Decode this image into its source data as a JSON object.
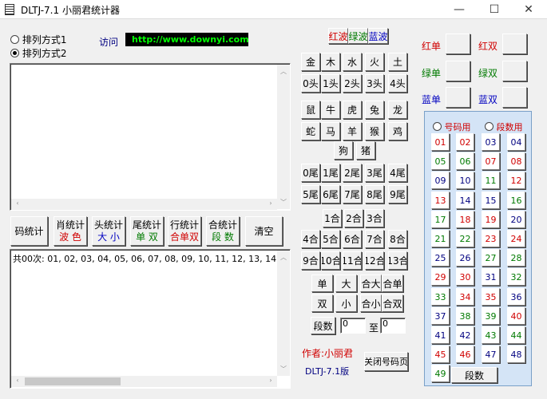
{
  "window": {
    "title": "DLTJ-7.1 小丽君统计器",
    "min": "—",
    "max": "☐",
    "close": "✕"
  },
  "radio": [
    {
      "label": "排列方式1",
      "checked": false
    },
    {
      "label": "排列方式2",
      "checked": true
    }
  ],
  "visit": {
    "label": "访问",
    "url": "http://www.downyi.com"
  },
  "stats": {
    "code": "码统计",
    "xiao": [
      "肖统计",
      "波 色"
    ],
    "head": [
      "头统计",
      "大 小"
    ],
    "tail": [
      "尾统计",
      "单 双"
    ],
    "row": [
      "行统计",
      "合单双"
    ],
    "sum": [
      "合统计",
      "段 数"
    ],
    "clear": "清空"
  },
  "output_text": "共00次: 01, 02, 03, 04, 05, 06, 07, 08, 09, 10, 11, 12, 13, 14, 15, 16, 17, 1",
  "colors": {
    "red": "红波",
    "green": "绿波",
    "blue": "蓝波"
  },
  "elements": [
    "金",
    "木",
    "水",
    "火",
    "土"
  ],
  "heads": [
    "0头",
    "1头",
    "2头",
    "3头",
    "4头"
  ],
  "zodiac": [
    "鼠",
    "牛",
    "虎",
    "兔",
    "龙",
    "蛇",
    "马",
    "羊",
    "猴",
    "鸡",
    "狗",
    "猪"
  ],
  "tails": [
    "0尾",
    "1尾",
    "2尾",
    "3尾",
    "4尾",
    "5尾",
    "6尾",
    "7尾",
    "8尾",
    "9尾"
  ],
  "sums": [
    "1合",
    "2合",
    "3合",
    "4合",
    "5合",
    "6合",
    "7合",
    "8合",
    "9合",
    "10合",
    "11合",
    "12合",
    "13合"
  ],
  "parity": [
    "单",
    "大",
    "合大",
    "合单",
    "双",
    "小",
    "合小",
    "合双"
  ],
  "segment": {
    "label": "段数",
    "from": "0",
    "to_label": "至",
    "to": "0"
  },
  "author": "作者:小丽君",
  "version": "DLTJ-7.1版",
  "close_code": "关闭号码页",
  "odd_even": [
    {
      "label": "红单",
      "color": "#d00000"
    },
    {
      "label": "红双",
      "color": "#d00000"
    },
    {
      "label": "绿单",
      "color": "#007a00"
    },
    {
      "label": "绿双",
      "color": "#007a00"
    },
    {
      "label": "蓝单",
      "color": "#0000c0"
    },
    {
      "label": "蓝双",
      "color": "#0000c0"
    }
  ],
  "mode": [
    {
      "label": "号码用",
      "checked": false
    },
    {
      "label": "段数用",
      "checked": false
    }
  ],
  "numbers": [
    "01",
    "02",
    "03",
    "04",
    "05",
    "06",
    "07",
    "08",
    "09",
    "10",
    "11",
    "12",
    "13",
    "14",
    "15",
    "16",
    "17",
    "18",
    "19",
    "20",
    "21",
    "22",
    "23",
    "24",
    "25",
    "26",
    "27",
    "28",
    "29",
    "30",
    "31",
    "32",
    "33",
    "34",
    "35",
    "36",
    "37",
    "38",
    "39",
    "40",
    "41",
    "42",
    "43",
    "44",
    "45",
    "46",
    "47",
    "48",
    "49"
  ],
  "number_colors": [
    "r",
    "r",
    "b",
    "b",
    "g",
    "g",
    "r",
    "r",
    "b",
    "b",
    "g",
    "r",
    "r",
    "b",
    "b",
    "g",
    "g",
    "r",
    "r",
    "b",
    "g",
    "g",
    "r",
    "r",
    "b",
    "b",
    "g",
    "g",
    "r",
    "r",
    "b",
    "g",
    "g",
    "r",
    "r",
    "b",
    "b",
    "g",
    "g",
    "r",
    "b",
    "b",
    "g",
    "g",
    "r",
    "r",
    "b",
    "b",
    "g"
  ],
  "segments_btn": "段数"
}
